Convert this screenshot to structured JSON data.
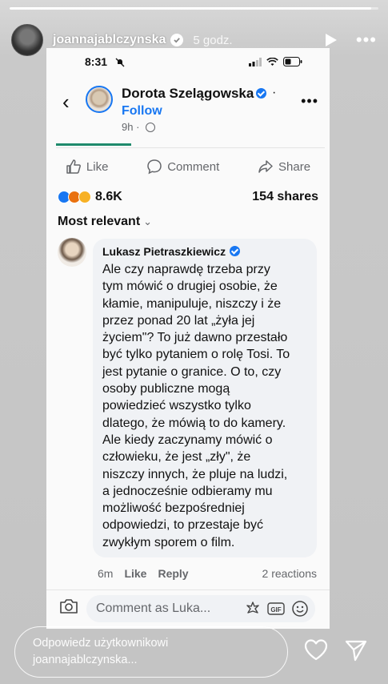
{
  "story": {
    "username": "joannajablczynska",
    "time_ago": "5 godz.",
    "progress": 0.98,
    "reply_placeholder_line1": "Odpowiedz użytkownikowi",
    "reply_placeholder_line2": "joannajablczynska..."
  },
  "screenshot": {
    "status_time": "8:31",
    "page_name": "Dorota Szelągowska",
    "follow_label": "Follow",
    "post_time": "9h",
    "actions": {
      "like": "Like",
      "comment": "Comment",
      "share": "Share"
    },
    "reaction_count": "8.6K",
    "shares": "154 shares",
    "sort_label": "Most relevant",
    "comment": {
      "author": "Lukasz Pietraszkiewicz",
      "lines": [
        "Ale czy naprawdę trzeba przy",
        "tym mówić o drugiej osobie, że",
        "kłamie, manipuluje, niszczy i że",
        "przez ponad 20 lat „żyła jej",
        "życiem\"? To już dawno przestało",
        "być tylko pytaniem o rolę Tosi. To",
        "jest pytanie o granice. O to, czy",
        "osoby publiczne mogą",
        "powiedzieć wszystko tylko",
        "dlatego, że mówią to do kamery.",
        "Ale kiedy zaczynamy mówić o",
        "człowieku, że jest „zły\", że",
        "niszczy innych, że pluje na ludzi,",
        "a jednocześnie odbieramy mu",
        "możliwość bezpośredniej",
        "odpowiedzi, to przestaje być",
        "zwykłym sporem o film."
      ],
      "age": "6m",
      "like": "Like",
      "reply": "Reply",
      "reactions": "2 reactions"
    },
    "composer_placeholder": "Comment as Luka..."
  },
  "colors": {
    "fb_blue": "#1877f2",
    "text": "#111111",
    "muted": "#65676b"
  }
}
